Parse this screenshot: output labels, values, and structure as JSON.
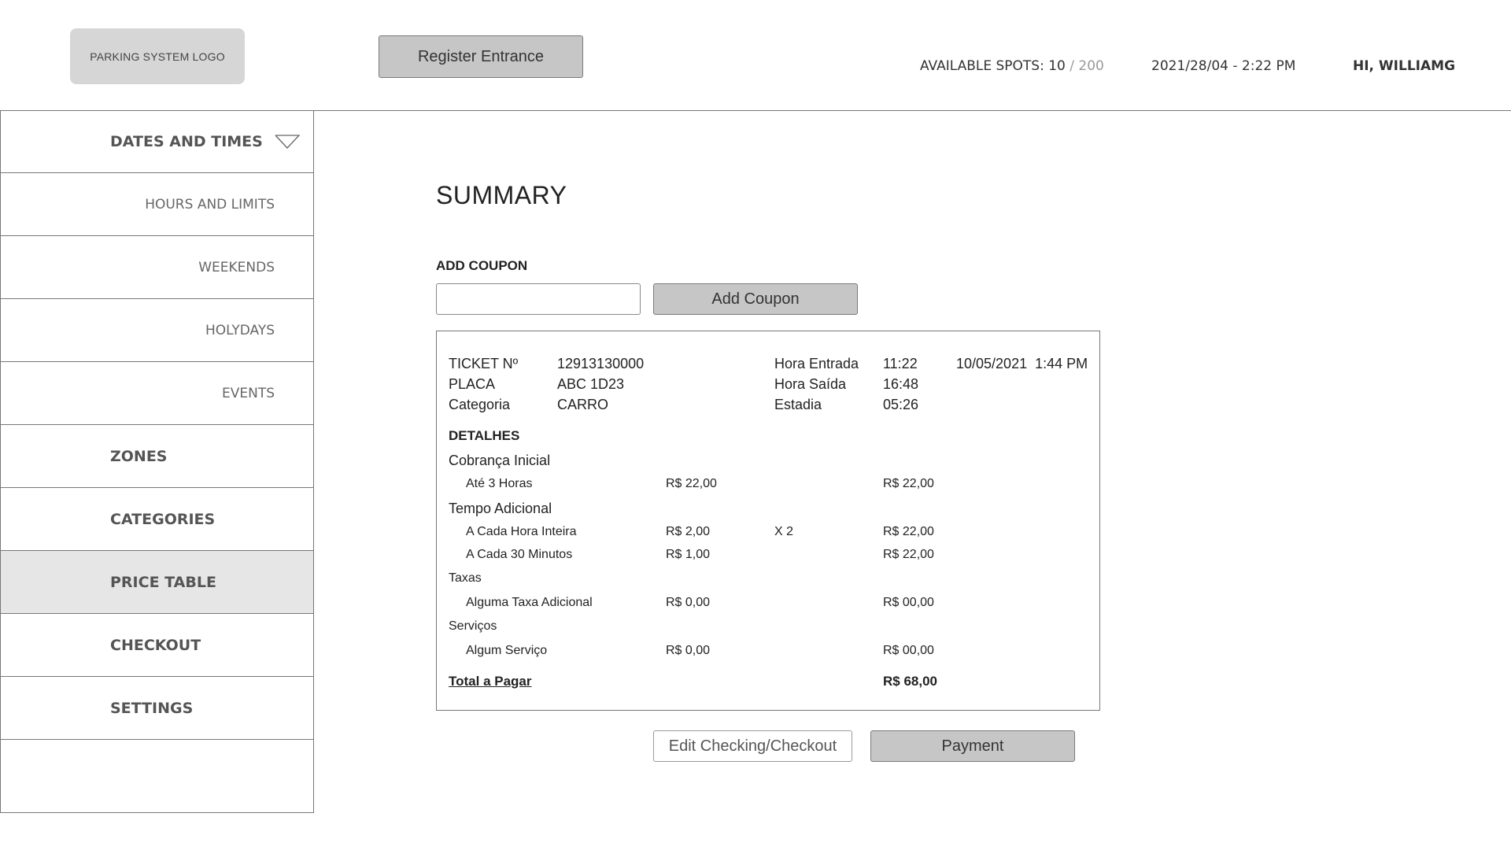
{
  "header": {
    "logo_text": "PARKING SYSTEM LOGO",
    "register_label": "Register Entrance",
    "spots_label": "AVAILABLE SPOTS: 10",
    "spots_total": " / 200",
    "datetime": "2021/28/04 - 2:22 PM",
    "greeting": "HI, WILLIAMG"
  },
  "sidebar": {
    "items": [
      {
        "label": "DATES AND TIMES"
      },
      {
        "label": "HOURS AND LIMITS"
      },
      {
        "label": "WEEKENDS"
      },
      {
        "label": "HOLYDAYS"
      },
      {
        "label": "EVENTS"
      },
      {
        "label": "ZONES"
      },
      {
        "label": "CATEGORIES"
      },
      {
        "label": "PRICE TABLE"
      },
      {
        "label": "CHECKOUT"
      },
      {
        "label": "SETTINGS"
      }
    ],
    "chevron_icon": "chevron-down-icon"
  },
  "main": {
    "title": "SUMMARY",
    "coupon_label": "ADD COUPON",
    "coupon_value": "",
    "add_coupon_label": "Add Coupon",
    "ticket": {
      "ticket_label": "TICKET Nº",
      "ticket_value": "12913130000",
      "placa_label": "PLACA",
      "placa_value": "ABC 1D23",
      "categoria_label": "Categoria",
      "categoria_value": "CARRO",
      "entrada_label": "Hora Entrada",
      "entrada_value": "11:22",
      "saida_label": "Hora Saída",
      "saida_value": "16:48",
      "estadia_label": "Estadia",
      "estadia_value": "05:26",
      "date_value": "10/05/2021  1:44 PM"
    },
    "details": {
      "heading": "DETALHES",
      "cobranca_label": "Cobrança Inicial",
      "ate3_label": "Até 3 Horas",
      "ate3_price": "R$ 22,00",
      "ate3_total": "R$ 22,00",
      "tempo_label": "Tempo Adicional",
      "hora_label": "A Cada Hora Inteira",
      "hora_price": "R$ 2,00",
      "hora_mult": "X 2",
      "hora_total": "R$ 22,00",
      "min30_label": "A Cada 30 Minutos",
      "min30_price": "R$ 1,00",
      "min30_total": "R$ 22,00",
      "taxas_label": "Taxas",
      "taxa_label": "Alguma Taxa Adicional",
      "taxa_price": "R$ 0,00",
      "taxa_total": "R$ 00,00",
      "servicos_label": "Serviços",
      "servico_label": "Algum Serviço",
      "servico_price": "R$ 0,00",
      "servico_total": "R$ 00,00",
      "total_label": "Total a Pagar",
      "total_value": "R$ 68,00"
    },
    "edit_label": "Edit Checking/Checkout",
    "payment_label": "Payment"
  }
}
